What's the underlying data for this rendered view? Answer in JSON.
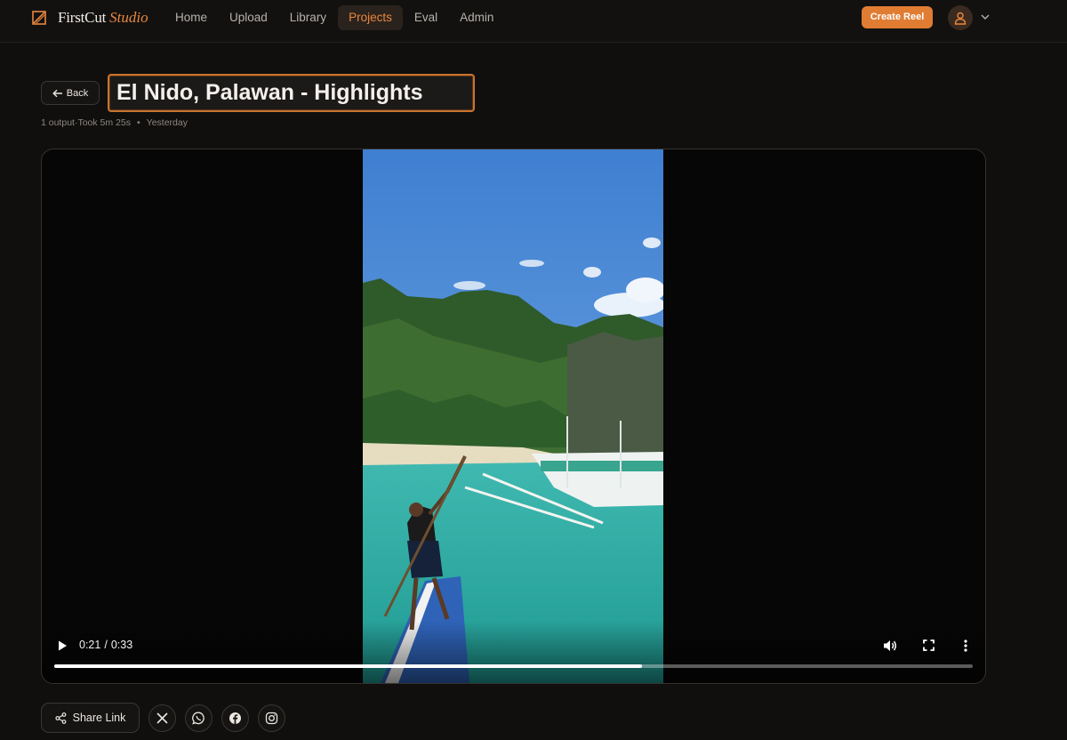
{
  "app": {
    "brand_main": "FirstCut",
    "brand_accent": "Studio",
    "accent_color": "#e07d33"
  },
  "nav": {
    "items": [
      {
        "label": "Home",
        "active": false
      },
      {
        "label": "Upload",
        "active": false
      },
      {
        "label": "Library",
        "active": false
      },
      {
        "label": "Projects",
        "active": true
      },
      {
        "label": "Eval",
        "active": false
      },
      {
        "label": "Admin",
        "active": false
      }
    ],
    "create_label": "Create Reel"
  },
  "project": {
    "back_label": "Back",
    "title": "El Nido, Palawan - Highlights",
    "outputs": "1 output",
    "duration": "Took 5m 25s",
    "date": "Yesterday"
  },
  "player": {
    "current_time": "0:21",
    "time_separator": "/",
    "total_time": "0:33",
    "progress_fraction": 0.64
  },
  "share": {
    "share_link_label": "Share Link",
    "icons": [
      "x-icon",
      "whatsapp-icon",
      "facebook-icon",
      "instagram-icon"
    ]
  }
}
